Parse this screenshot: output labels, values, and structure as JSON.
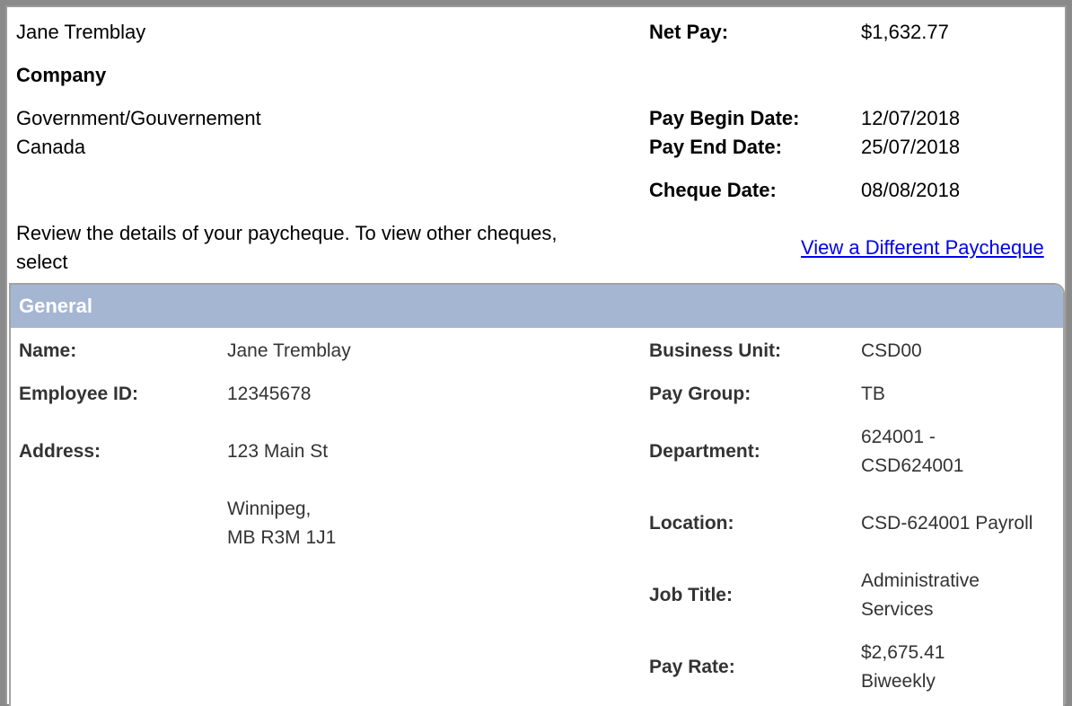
{
  "employee_name": "Jane Tremblay",
  "company_label": "Company",
  "company_line1": "Government/Gouvernement",
  "company_line2": "Canada",
  "summary": {
    "net_pay_label": "Net Pay:",
    "net_pay_value": "$1,632.77",
    "pay_begin_label": "Pay Begin Date:",
    "pay_begin_value": "12/07/2018",
    "pay_end_label": "Pay End Date:",
    "pay_end_value": "25/07/2018",
    "cheque_date_label": "Cheque Date:",
    "cheque_date_value": "08/08/2018"
  },
  "instructions_line1": "Review the details of your paycheque. To view other cheques,",
  "instructions_line2": "select",
  "view_different_link": "View a Different Paycheque",
  "general": {
    "header": "General",
    "name_label": "Name:",
    "name_value": "Jane Tremblay",
    "employee_id_label": "Employee ID:",
    "employee_id_value": "12345678",
    "address_label": "Address:",
    "address_line1": "123 Main St",
    "address_line2": "Winnipeg,",
    "address_line3": "MB R3M 1J1",
    "business_unit_label": "Business Unit:",
    "business_unit_value": "CSD00",
    "pay_group_label": "Pay Group:",
    "pay_group_value": "TB",
    "department_label": "Department:",
    "department_line1": "624001 -",
    "department_line2": "CSD624001",
    "location_label": "Location:",
    "location_value": "CSD-624001 Payroll",
    "job_title_label": "Job Title:",
    "job_title_line1": "Administrative",
    "job_title_line2": "Services",
    "pay_rate_label": "Pay Rate:",
    "pay_rate_line1": "$2,675.41",
    "pay_rate_line2": "Biweekly"
  }
}
